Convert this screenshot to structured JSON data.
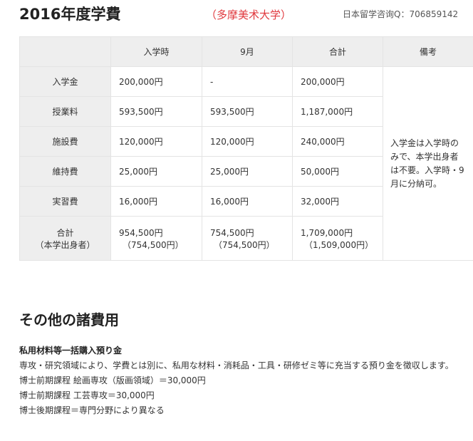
{
  "header": {
    "title": "2016年度学費",
    "school": "（多摩美术大学）",
    "contact": "日本留学咨询Q：706859142"
  },
  "table": {
    "columns": [
      "",
      "入学時",
      "9月",
      "合計",
      "備考"
    ],
    "rows": [
      {
        "label": "入学金",
        "entrance": "200,000円",
        "september": "-",
        "total": "200,000円"
      },
      {
        "label": "授業料",
        "entrance": "593,500円",
        "september": "593,500円",
        "total": "1,187,000円"
      },
      {
        "label": "施設費",
        "entrance": "120,000円",
        "september": "120,000円",
        "total": "240,000円"
      },
      {
        "label": "維持費",
        "entrance": "25,000円",
        "september": "25,000円",
        "total": "50,000円"
      },
      {
        "label": "実習費",
        "entrance": "16,000円",
        "september": "16,000円",
        "total": "32,000円"
      }
    ],
    "total_row": {
      "label": "合計",
      "label_sub": "（本学出身者）",
      "entrance": "954,500円",
      "entrance_sub": "（754,500円）",
      "september": "754,500円",
      "september_sub": "（754,500円）",
      "total": "1,709,000円",
      "total_sub": "（1,509,000円）"
    },
    "note": "入学金は入学時のみで、本学出身者は不要。入学時・9月に分納可。"
  },
  "other_fees": {
    "title": "その他の諸費用",
    "heading": "私用材料等一括購入預り金",
    "description": "専攻・研究領域により、学費とは別に、私用な材料・消耗品・工具・研修ゼミ等に充当する預り金を徴収します。",
    "items": [
      "博士前期課程 絵画専攻（版画領域）＝30,000円",
      "博士前期課程 工芸専攻＝30,000円",
      "博士後期課程＝専門分野により異なる"
    ]
  }
}
